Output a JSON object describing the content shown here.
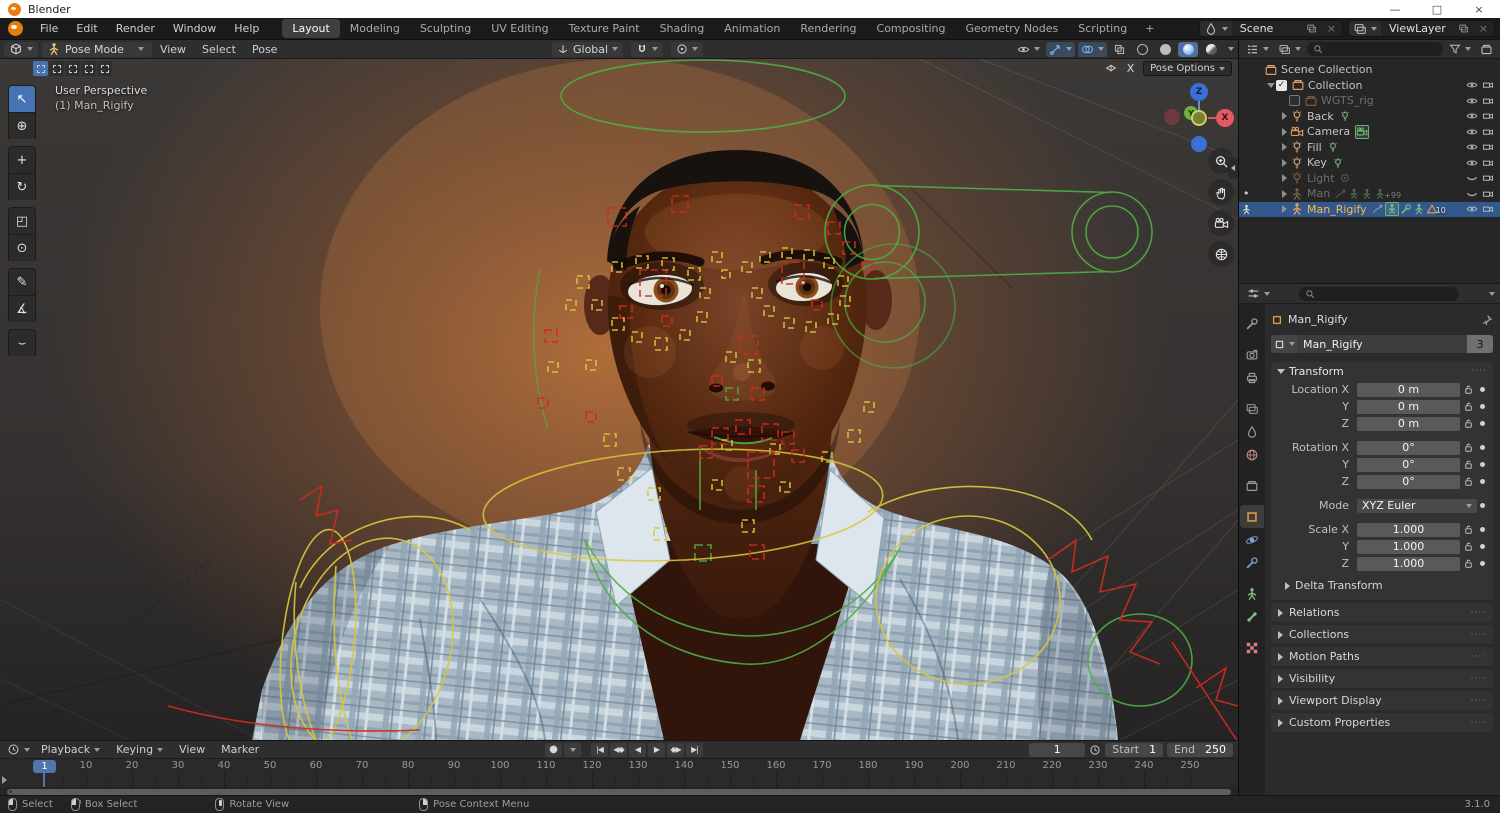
{
  "window": {
    "title": "Blender",
    "minimize": "—",
    "maximize": "□",
    "close": "×"
  },
  "topbar": {
    "menus": [
      "File",
      "Edit",
      "Render",
      "Window",
      "Help"
    ],
    "workspaces": [
      {
        "label": "Layout",
        "active": true
      },
      {
        "label": "Modeling"
      },
      {
        "label": "Sculpting"
      },
      {
        "label": "UV Editing"
      },
      {
        "label": "Texture Paint"
      },
      {
        "label": "Shading"
      },
      {
        "label": "Animation"
      },
      {
        "label": "Rendering"
      },
      {
        "label": "Compositing"
      },
      {
        "label": "Geometry Nodes"
      },
      {
        "label": "Scripting"
      }
    ],
    "add_tab": "+",
    "scene_name": "Scene",
    "view_layer_name": "ViewLayer",
    "close_glyph": "×"
  },
  "tool_header": {
    "mode_label": "Pose Mode",
    "menus": [
      "View",
      "Select",
      "Pose"
    ],
    "orientation_label": "Global"
  },
  "viewport": {
    "view_label": "User Perspective",
    "object_label": "(1) Man_Rigify",
    "mirror_label": "X",
    "pose_options_label": "Pose Options",
    "axis": {
      "x": "X",
      "y": "Y",
      "z": "Z"
    },
    "select_modes": [
      {
        "name": "set",
        "active": true
      },
      {
        "name": "extend"
      },
      {
        "name": "subtract"
      },
      {
        "name": "invert"
      },
      {
        "name": "intersect"
      }
    ],
    "tools": [
      {
        "name": "tweak-select",
        "glyph": "↖",
        "active": true
      },
      {
        "name": "cursor",
        "glyph": "⊕"
      },
      {
        "name": "move",
        "glyph": "+",
        "group_start": true
      },
      {
        "name": "rotate",
        "glyph": "↻"
      },
      {
        "name": "scale",
        "glyph": "◰",
        "group_start": true
      },
      {
        "name": "transform",
        "glyph": "⊙"
      },
      {
        "name": "annotate",
        "glyph": "✎",
        "group_start": true
      },
      {
        "name": "measure",
        "glyph": "∡"
      },
      {
        "name": "pose-breakdowner",
        "glyph": "⌣",
        "group_start": true
      }
    ]
  },
  "outliner": {
    "rows": [
      {
        "label": "Scene Collection",
        "icon": "collection",
        "depth": 0,
        "arrow": "none"
      },
      {
        "label": "Collection",
        "icon": "collection",
        "depth": 1,
        "arrow": "down",
        "has_checkbox": true,
        "checkbox_on": true,
        "t1": "eye",
        "t2": "cam"
      },
      {
        "label": "WGTS_rig",
        "icon": "collection",
        "depth": 2,
        "arrow": "none",
        "muted": true,
        "has_checkbox": true,
        "checkbox_on": false,
        "t1": "eye",
        "t2": "cam"
      },
      {
        "label": "Back",
        "icon": "light",
        "depth": 2,
        "arrow": "right",
        "extras": [
          {
            "icon": "light-data"
          }
        ],
        "t1": "eye",
        "t2": "cam"
      },
      {
        "label": "Camera",
        "icon": "camera-obj",
        "depth": 2,
        "arrow": "right",
        "extras": [
          {
            "icon": "camera-data",
            "boxed": true
          }
        ],
        "t1": "eye",
        "t2": "cam"
      },
      {
        "label": "Fill",
        "icon": "light",
        "depth": 2,
        "arrow": "right",
        "extras": [
          {
            "icon": "light-data"
          }
        ],
        "t1": "eye",
        "t2": "cam"
      },
      {
        "label": "Key",
        "icon": "light",
        "depth": 2,
        "arrow": "right",
        "extras": [
          {
            "icon": "light-data"
          }
        ],
        "t1": "eye",
        "t2": "cam"
      },
      {
        "label": "Light",
        "icon": "light",
        "depth": 2,
        "arrow": "right",
        "muted": true,
        "extras": [
          {
            "icon": "pointlight"
          }
        ],
        "t1": "eye-closed",
        "t2": "cam"
      },
      {
        "label": "Man",
        "icon": "armature",
        "depth": 2,
        "arrow": "right",
        "muted": true,
        "marker_dot": true,
        "extras": [
          {
            "icon": "action"
          },
          {
            "icon": "pose"
          },
          {
            "icon": "pose"
          },
          {
            "icon": "pose",
            "badge": "+99"
          }
        ],
        "t1": "eye-closed",
        "t2": "cam"
      },
      {
        "label": "Man_Rigify",
        "icon": "armature",
        "depth": 2,
        "arrow": "right",
        "selected": true,
        "active": true,
        "marker_sym": "armature",
        "extras": [
          {
            "icon": "action"
          },
          {
            "icon": "pose",
            "boxed": true
          },
          {
            "icon": "constraint"
          },
          {
            "icon": "pose"
          },
          {
            "icon": "triangle",
            "badge": "10"
          }
        ],
        "t1": "eye",
        "t2": "cam"
      }
    ]
  },
  "properties": {
    "breadcrumb": "Man_Rigify",
    "name_value": "Man_Rigify",
    "users_badge": "3",
    "tabs": [
      {
        "name": "tool",
        "sym": "wrench"
      },
      {
        "name": "render",
        "sym": "camera-back",
        "group": true
      },
      {
        "name": "output",
        "sym": "printer"
      },
      {
        "name": "view-layer",
        "sym": "photos",
        "group": true
      },
      {
        "name": "scene",
        "sym": "droplet"
      },
      {
        "name": "world",
        "sym": "globe",
        "color": "#c98a8a"
      },
      {
        "name": "collection",
        "sym": "collection",
        "group": true
      },
      {
        "name": "object",
        "sym": "square",
        "active": true,
        "color": "#e8953c",
        "group": true
      },
      {
        "name": "physics",
        "sym": "orbit",
        "color": "#7aa0d8"
      },
      {
        "name": "constraints",
        "sym": "constraint",
        "color": "#7aa0d8"
      },
      {
        "name": "object-data",
        "sym": "armature",
        "color": "#7cc383",
        "group": true
      },
      {
        "name": "bone",
        "sym": "bone",
        "color": "#7cc383"
      },
      {
        "name": "texture",
        "sym": "checker",
        "color": "#d87f7f",
        "group": true
      }
    ],
    "transform": {
      "title": "Transform",
      "rows": [
        {
          "label": "Location X",
          "value": "0 m",
          "lock": true,
          "dot": true
        },
        {
          "label": "Y",
          "value": "0 m",
          "lock": true,
          "dot": true
        },
        {
          "label": "Z",
          "value": "0 m",
          "lock": true,
          "dot": true
        },
        {
          "label": "Rotation X",
          "value": "0°",
          "lock": true,
          "dot": true,
          "group_start": true
        },
        {
          "label": "Y",
          "value": "0°",
          "lock": true,
          "dot": true
        },
        {
          "label": "Z",
          "value": "0°",
          "lock": true,
          "dot": true
        },
        {
          "label": "Mode",
          "value": "XYZ Euler",
          "dropdown": true,
          "dot": true,
          "group_start": true
        },
        {
          "label": "Scale X",
          "value": "1.000",
          "lock": true,
          "dot": true,
          "group_start": true
        },
        {
          "label": "Y",
          "value": "1.000",
          "lock": true,
          "dot": true
        },
        {
          "label": "Z",
          "value": "1.000",
          "lock": true,
          "dot": true
        }
      ],
      "delta_label": "Delta Transform"
    },
    "sections": [
      "Relations",
      "Collections",
      "Motion Paths",
      "Visibility",
      "Viewport Display",
      "Custom Properties"
    ]
  },
  "timeline": {
    "menus": [
      {
        "label": "Playback",
        "caret": true
      },
      {
        "label": "Keying",
        "caret": true
      },
      {
        "label": "View"
      },
      {
        "label": "Marker"
      }
    ],
    "playback": [
      {
        "name": "jump-start",
        "glyph": "|◀"
      },
      {
        "name": "prev-keyframe",
        "glyph": "◀◆"
      },
      {
        "name": "play-reverse",
        "glyph": "◀"
      },
      {
        "name": "play",
        "glyph": "▶"
      },
      {
        "name": "next-keyframe",
        "glyph": "◆▶"
      },
      {
        "name": "jump-end",
        "glyph": "▶|"
      }
    ],
    "record_glyph": "●",
    "current_frame": "1",
    "start_label": "Start",
    "start_value": "1",
    "end_label": "End",
    "end_value": "250",
    "ticks": [
      10,
      20,
      30,
      40,
      50,
      60,
      70,
      80,
      90,
      100,
      110,
      120,
      130,
      140,
      150,
      160,
      170,
      180,
      190,
      200,
      210,
      220,
      230,
      240,
      250
    ]
  },
  "status_bar": {
    "hints": [
      {
        "mouse": "left",
        "label": "Select"
      },
      {
        "mouse": "drag",
        "label": "Box Select"
      },
      {
        "mouse": "middle",
        "label": "Rotate View"
      },
      {
        "mouse": "right",
        "label": "Pose Context Menu"
      }
    ],
    "version": "3.1.0"
  },
  "colors": {
    "accent": "#4772b3",
    "selection": "#33598c",
    "active_object_text": "#ffb74d",
    "rig_yellow": "#d9c73c",
    "rig_red": "#cf2b20",
    "rig_green": "#4fae46",
    "header": "#2e2e2e",
    "glow": "#c8763a"
  }
}
